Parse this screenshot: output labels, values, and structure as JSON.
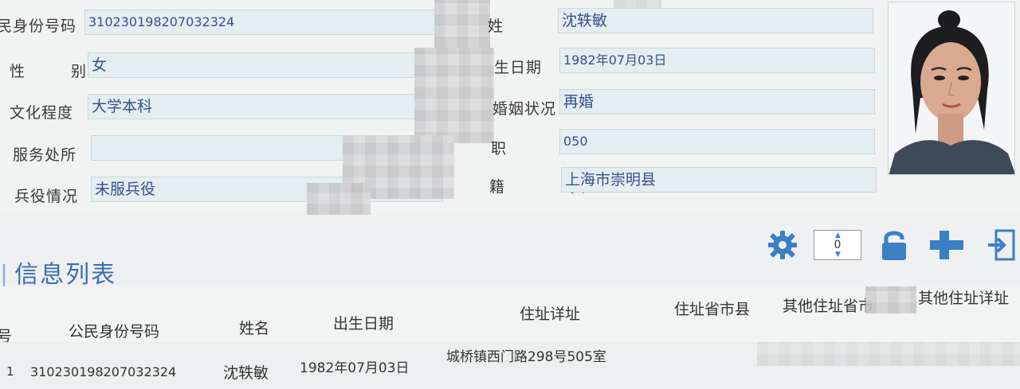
{
  "form": {
    "id_label": "民身份号码",
    "id_value": "310230198207032324",
    "gender_label": "性 别",
    "gender_value": "女",
    "education_label": "文化程度",
    "education_value": "大学本科",
    "service_label": "服务处所",
    "service_value": "",
    "military_label": "兵役情况",
    "military_value": "未服兵役",
    "name_label": "姓 名",
    "name_value": "沈轶敏",
    "birth_label": "生日期",
    "birth_value": "1982年07月03日",
    "marital_label": "婚姻状况",
    "marital_value": "再婚",
    "job_label": "职 业",
    "job_value": "050",
    "native_label": "籍 贯",
    "native_value": "上海市崇明县"
  },
  "toolbar": {
    "counter_value": "0"
  },
  "list": {
    "title": "信息列表",
    "columns": [
      "号",
      "公民身份号码",
      "姓名",
      "出生日期",
      "住址详址",
      "住址省市县",
      "其他住址省市",
      "其他住址详址"
    ],
    "rows": [
      {
        "index": "1",
        "id": "310230198207032324",
        "name": "沈轶敏",
        "birth": "1982年07月03日",
        "address": "城桥镇西门路298号505室"
      }
    ]
  },
  "colors": {
    "accent": "#3b7fc4",
    "field_bg": "#e4eef0",
    "field_text": "#37508a"
  }
}
